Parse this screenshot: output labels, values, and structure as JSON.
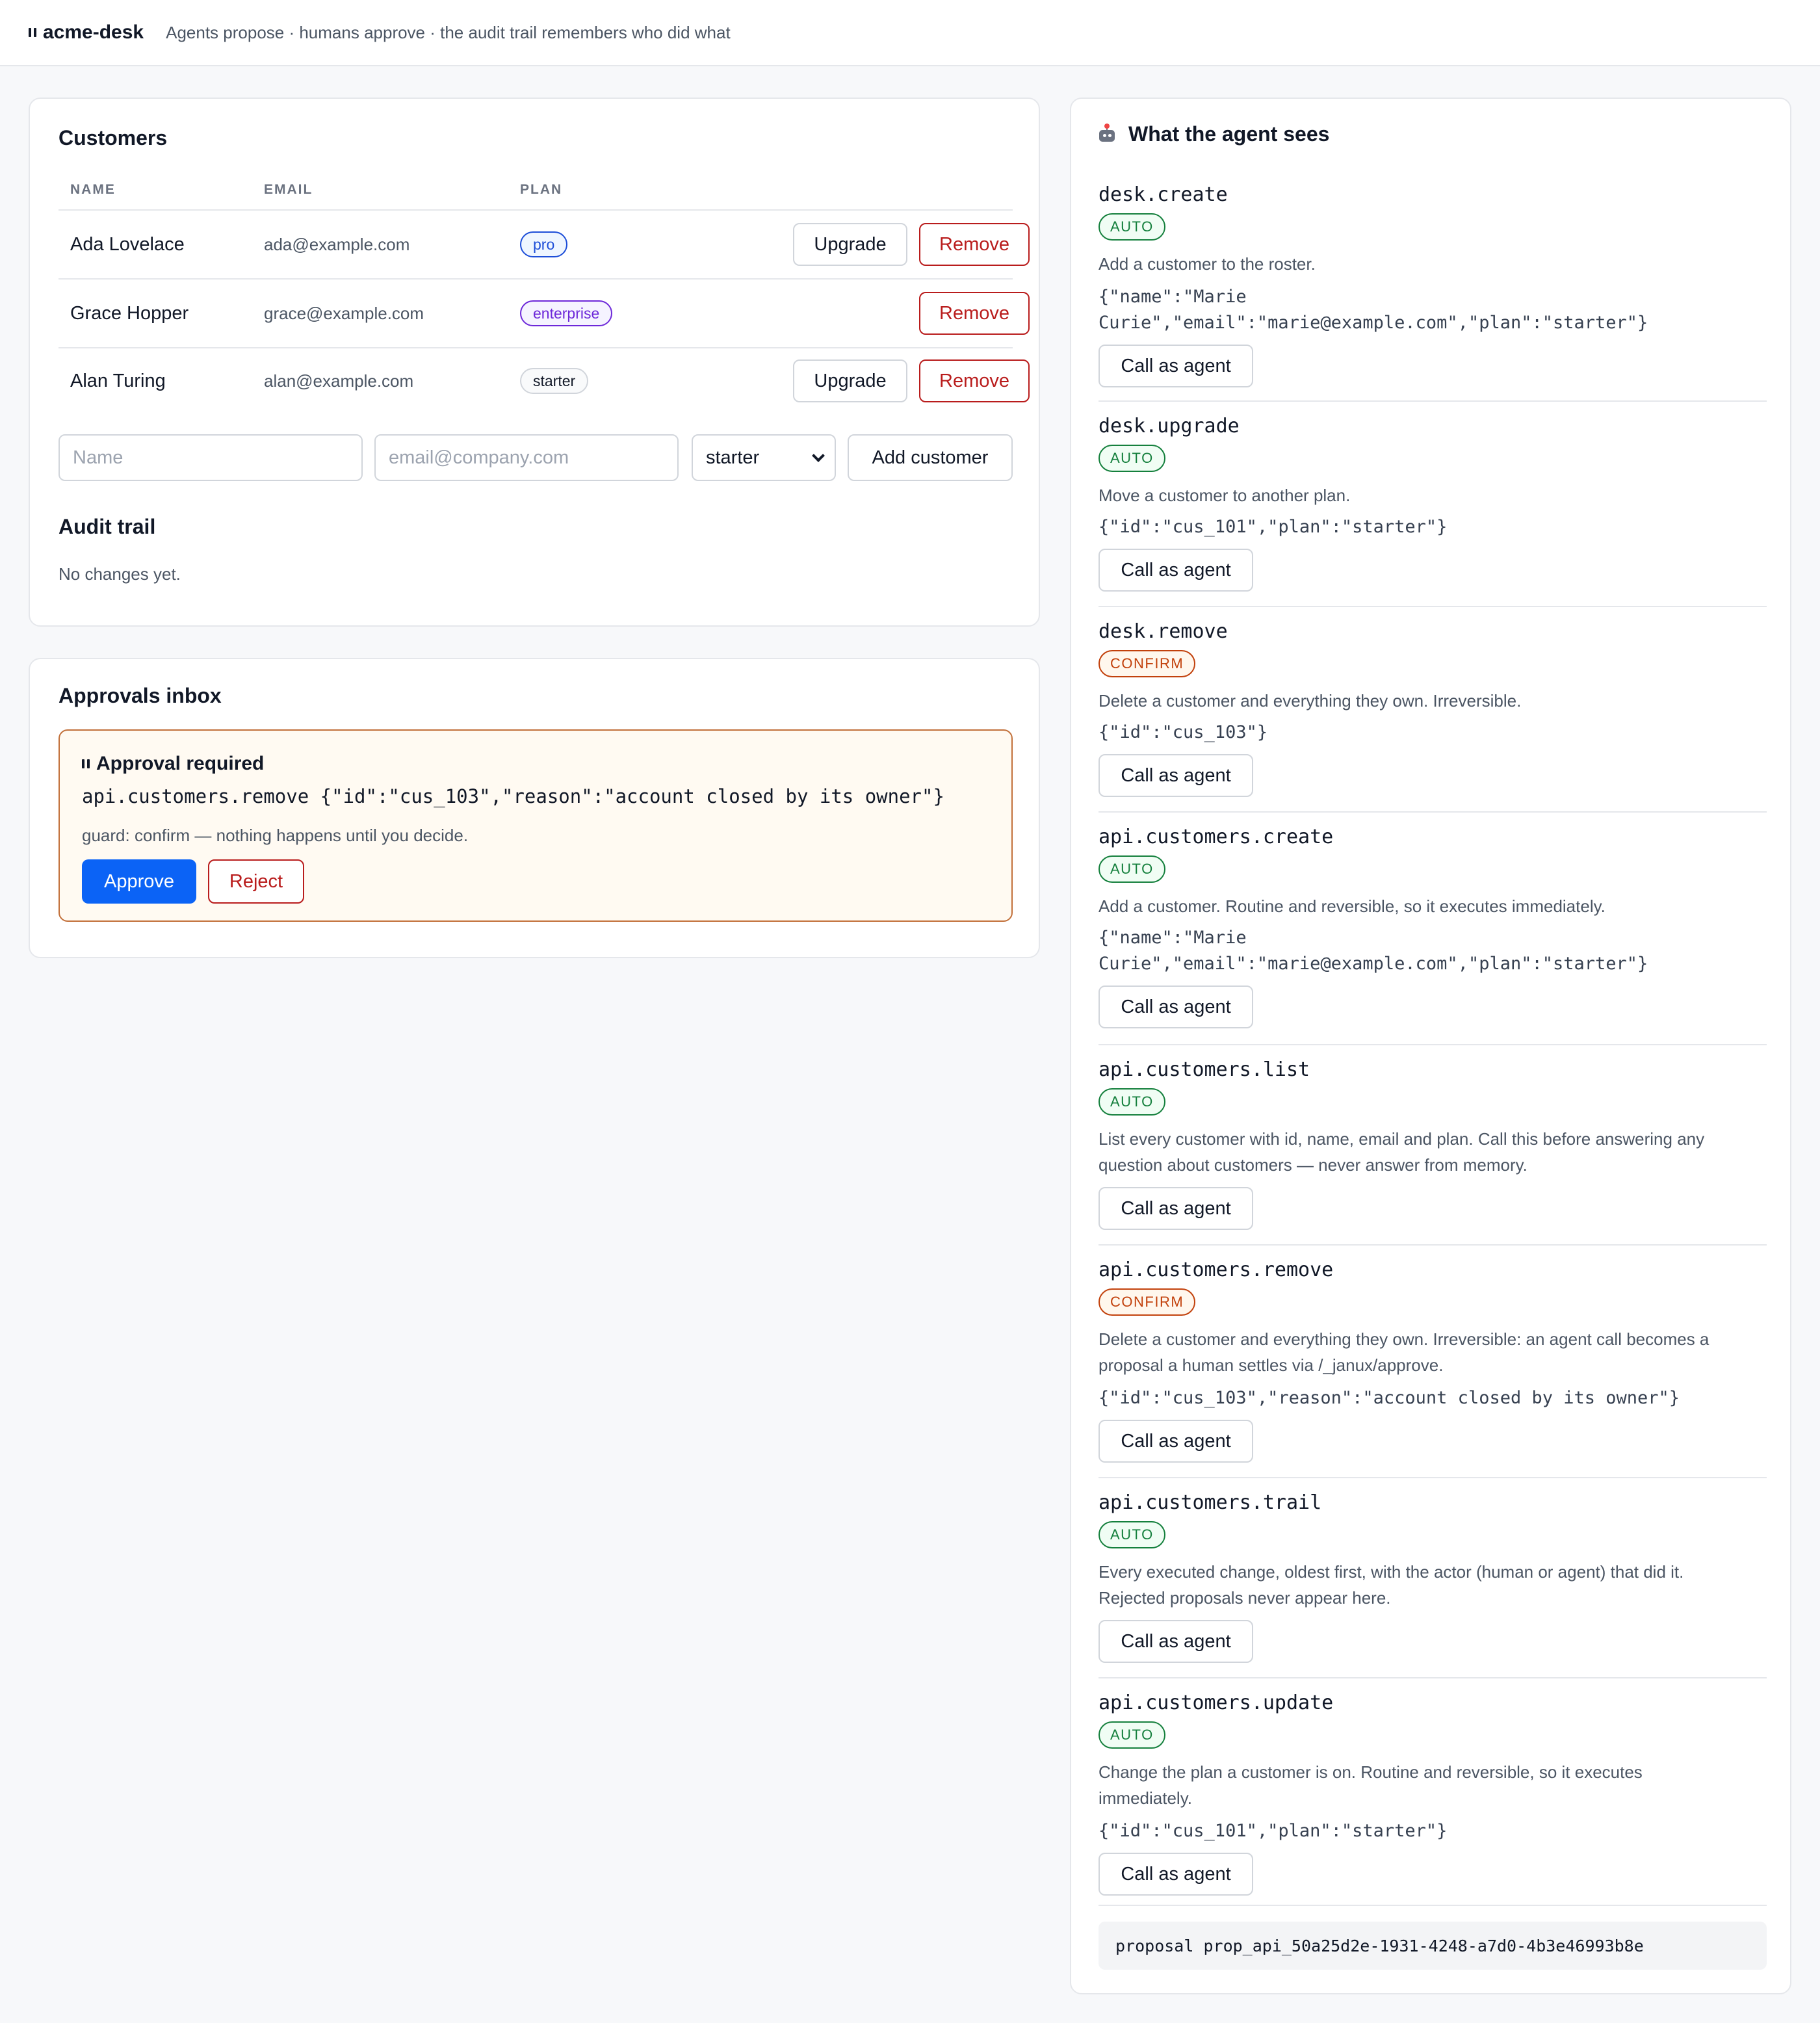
{
  "header": {
    "brand": "acme-desk",
    "tagline": "Agents propose · humans approve · the audit trail remembers who did what"
  },
  "customers": {
    "title": "Customers",
    "columns": [
      "NAME",
      "EMAIL",
      "PLAN"
    ],
    "rows": [
      {
        "name": "Ada Lovelace",
        "email": "ada@example.com",
        "plan": "pro",
        "upgrade": "Upgrade",
        "remove": "Remove"
      },
      {
        "name": "Grace Hopper",
        "email": "grace@example.com",
        "plan": "enterprise",
        "remove": "Remove"
      },
      {
        "name": "Alan Turing",
        "email": "alan@example.com",
        "plan": "starter",
        "upgrade": "Upgrade",
        "remove": "Remove"
      }
    ],
    "form": {
      "name_placeholder": "Name",
      "email_placeholder": "email@company.com",
      "plan_selected": "starter",
      "submit_label": "Add customer"
    }
  },
  "audit": {
    "title": "Audit trail",
    "empty": "No changes yet."
  },
  "approvals": {
    "title": "Approvals inbox",
    "item": {
      "heading": "Approval required",
      "call": "api.customers.remove {\"id\":\"cus_103\",\"reason\":\"account closed by its owner\"}",
      "guard": "guard: confirm — nothing happens until you decide.",
      "approve_label": "Approve",
      "reject_label": "Reject"
    }
  },
  "agent": {
    "title": "What the agent sees",
    "call_label": "Call as agent",
    "tools": [
      {
        "name": "desk.create",
        "guard": "AUTO",
        "desc": "Add a customer to the roster.",
        "args_l1": "{\"name\":\"Marie",
        "args_l2": "Curie\",\"email\":\"marie@example.com\",\"plan\":\"starter\"}"
      },
      {
        "name": "desk.upgrade",
        "guard": "AUTO",
        "desc": "Move a customer to another plan.",
        "args": "{\"id\":\"cus_101\",\"plan\":\"starter\"}"
      },
      {
        "name": "desk.remove",
        "guard": "CONFIRM",
        "desc": "Delete a customer and everything they own. Irreversible.",
        "args": "{\"id\":\"cus_103\"}"
      },
      {
        "name": "api.customers.create",
        "guard": "AUTO",
        "desc": "Add a customer. Routine and reversible, so it executes immediately.",
        "args_l1": "{\"name\":\"Marie",
        "args_l2": "Curie\",\"email\":\"marie@example.com\",\"plan\":\"starter\"}"
      },
      {
        "name": "api.customers.list",
        "guard": "AUTO",
        "desc_l1": "List every customer with id, name, email and plan. Call this before answering any",
        "desc_l2": "question about customers — never answer from memory."
      },
      {
        "name": "api.customers.remove",
        "guard": "CONFIRM",
        "desc_l1": "Delete a customer and everything they own. Irreversible: an agent call becomes a",
        "desc_l2": "proposal a human settles via /_janux/approve.",
        "args": "{\"id\":\"cus_103\",\"reason\":\"account closed by its owner\"}"
      },
      {
        "name": "api.customers.trail",
        "guard": "AUTO",
        "desc_l1": "Every executed change, oldest first, with the actor (human or agent) that did it.",
        "desc_l2": "Rejected proposals never appear here."
      },
      {
        "name": "api.customers.update",
        "guard": "AUTO",
        "desc_l1": "Change the plan a customer is on. Routine and reversible, so it executes",
        "desc_l2": "immediately.",
        "args": "{\"id\":\"cus_101\",\"plan\":\"starter\"}"
      }
    ],
    "proposal": "proposal prop_api_50a25d2e-1931-4248-a7d0-4b3e46993b8e"
  },
  "colors": {
    "primary": "#0b63f6",
    "danger": "#b91c1c",
    "auto": "#15803d",
    "confirm": "#c2410c"
  }
}
